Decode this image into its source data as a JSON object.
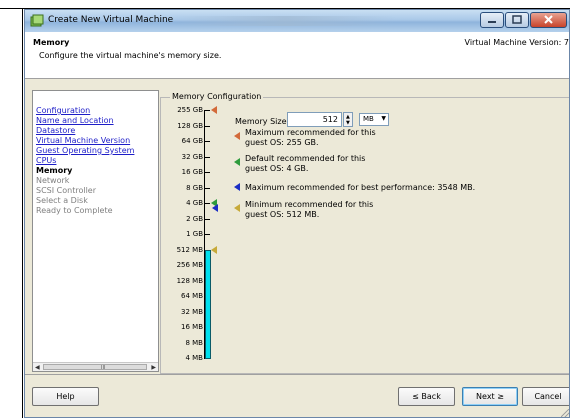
{
  "window": {
    "title": "Create New Virtual Machine"
  },
  "header": {
    "title": "Memory",
    "subtitle": "Configure the virtual machine's memory size.",
    "version": "Virtual Machine Version: 7"
  },
  "nav": {
    "items": [
      {
        "label": "Configuration",
        "state": "link"
      },
      {
        "label": "Name and Location",
        "state": "link"
      },
      {
        "label": "Datastore",
        "state": "link"
      },
      {
        "label": "Virtual Machine Version",
        "state": "link"
      },
      {
        "label": "Guest Operating System",
        "state": "link"
      },
      {
        "label": "CPUs",
        "state": "link"
      },
      {
        "label": "Memory",
        "state": "current"
      },
      {
        "label": "Network",
        "state": "disabled"
      },
      {
        "label": "SCSI Controller",
        "state": "disabled"
      },
      {
        "label": "Select a Disk",
        "state": "disabled"
      },
      {
        "label": "Ready to Complete",
        "state": "disabled"
      }
    ],
    "scroll_grip": "III"
  },
  "memory_config": {
    "group_label": "Memory Configuration",
    "size_label": "Memory Size:",
    "size_value": "512",
    "unit": "MB",
    "scale_labels": [
      "255 GB",
      "128 GB",
      "64 GB",
      "32 GB",
      "16 GB",
      "8 GB",
      "4 GB",
      "2 GB",
      "1 GB",
      "512 MB",
      "256 MB",
      "128 MB",
      "64 MB",
      "32 MB",
      "16 MB",
      "8 MB",
      "4 MB"
    ],
    "legend": [
      {
        "lines": [
          "Maximum recommended for this",
          "guest OS: 255 GB."
        ],
        "color": "#d36a3a"
      },
      {
        "lines": [
          "Default recommended for this",
          "guest OS: 4 GB."
        ],
        "color": "#2e9b3c"
      },
      {
        "lines": [
          "Maximum recommended for best performance: 3548 MB."
        ],
        "color": "#1b2ec4"
      },
      {
        "lines": [
          "Minimum recommended for this",
          "guest OS: 512 MB."
        ],
        "color": "#c7aa3a"
      }
    ],
    "markers": [
      {
        "label": "255 GB",
        "color": "#d36a3a"
      },
      {
        "label": "4 GB",
        "color": "#2e9b3c"
      },
      {
        "label": "3548 MB",
        "color": "#1b2ec4"
      },
      {
        "label": "512 MB",
        "color": "#c7aa3a"
      }
    ]
  },
  "footer": {
    "help": "Help",
    "back": "≤ Back",
    "next": "Next ≥",
    "cancel": "Cancel"
  }
}
